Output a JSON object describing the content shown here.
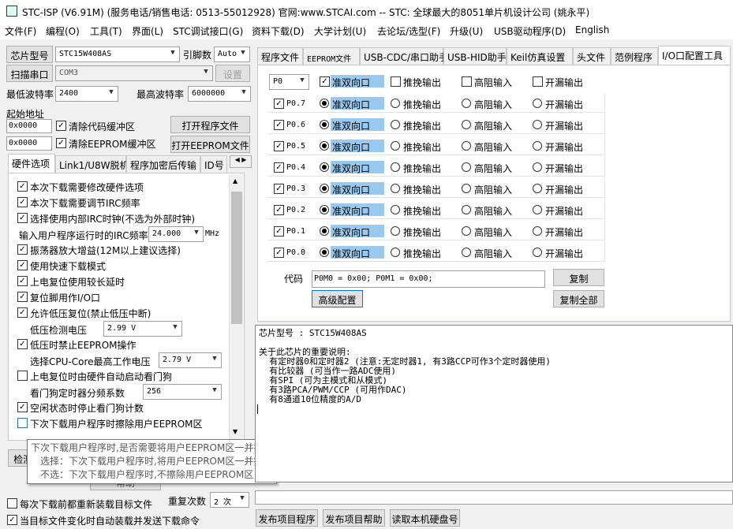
{
  "window": {
    "title": "STC-ISP (V6.91M) (服务电话/销售电话: 0513-55012928) 官网:www.STCAI.com  -- STC: 全球最大的8051单片机设计公司 (姚永平)"
  },
  "menu": [
    "文件(F)",
    "编程(O)",
    "工具(T)",
    "界面(L)",
    "STC调试接口(G)",
    "资料下载(D)",
    "大学计划(U)",
    "去论坛/选型(F)",
    "升级(U)",
    "USB驱动程序(D)",
    "English"
  ],
  "left": {
    "chip_type_label": "芯片型号",
    "chip_type_value": "STC15W408AS",
    "pin_label": "引脚数",
    "pin_value": "Auto",
    "scan_port_button": "扫描串口",
    "port_value": "COM3",
    "settings_button": "设置",
    "min_baud_label": "最低波特率",
    "min_baud_value": "2400",
    "max_baud_label": "最高波特率",
    "max_baud_value": "6000000",
    "start_addr_label": "起始地址",
    "addr1": "0x0000",
    "clear_code_buffer": "清除代码缓冲区",
    "open_program_file": "打开程序文件",
    "addr2": "0x0000",
    "clear_eeprom_buffer": "清除EEPROM缓冲区",
    "open_eeprom_file": "打开EEPROM文件",
    "tabs": [
      "硬件选项",
      "Link1/U8W脱机",
      "程序加密后传输",
      "ID号"
    ],
    "options": {
      "o1": "本次下载需要修改硬件选项",
      "o2": "本次下载需要调节IRC频率",
      "o3": "选择使用内部IRC时钟(不选为外部时钟)",
      "irc_label": "输入用户程序运行时的IRC频率",
      "irc_value": "24.000",
      "irc_unit": "MHz",
      "o4": "振荡器放大增益(12M以上建议选择)",
      "o5": "使用快速下载模式",
      "o6": "上电复位使用较长延时",
      "o7": "复位脚用作I/O口",
      "o8": "允许低压复位(禁止低压中断)",
      "lv_label": "低压检测电压",
      "lv_value": "2.99 V",
      "o9": "低压时禁止EEPROM操作",
      "cpu_label": "选择CPU-Core最高工作电压",
      "cpu_value": "2.79 V",
      "o10": "上电复位时由硬件自动启动看门狗",
      "wdt_label": "看门狗定时器分频系数",
      "wdt_value": "256",
      "o11": "空闲状态时停止看门狗计数",
      "o12": "下次下载用户程序时擦除用户EEPROM区"
    },
    "bottom_btn1": "检测MCU选项",
    "bottom_btn2": "帮助",
    "reload_each": "每次下载前都重新装载目标文件",
    "auto_send": "当目标文件变化时自动装载并发送下载命令",
    "repeat_label": "重复次数",
    "repeat_value": "2 次"
  },
  "tooltip": {
    "l1": "下次下载用户程序时,是否需要将用户EEPROM区一并擦除",
    "l2": "选择：下次下载用户程序时,将用户EEPROM区一并擦除",
    "l3": "不选：下次下载用户程序时,不擦除用户EEPROM区"
  },
  "right": {
    "tabs": [
      "程序文件",
      "EEPROM文件",
      "USB-CDC/串口助手",
      "USB-HID助手",
      "Keil仿真设置",
      "头文件",
      "范例程序",
      "I/O口配置工具"
    ],
    "port_select": "P0",
    "header_options": [
      "准双向口",
      "推挽输出",
      "高阻输入",
      "开漏输出"
    ],
    "pins": [
      "P0.7",
      "P0.6",
      "P0.5",
      "P0.4",
      "P0.3",
      "P0.2",
      "P0.1",
      "P0.0"
    ],
    "code_label": "代码",
    "code_value": "P0M0 = 0x00; P0M1 = 0x00;",
    "copy_button": "复制",
    "advanced_button": "高级配置",
    "copy_all_button": "复制全部"
  },
  "output": {
    "text": "芯片型号 : STC15W408AS\n\n关于此芯片的重要说明:\n  有定时器0和定时器2 (注意:无定时器1, 有3路CCP可作3个定时器使用)\n  有比较器 (可当作一路ADC使用)\n  有SPI (可为主模式和从模式)\n  有3路PCA/PWM/CCP (可用作DAC)\n  有8通道10位精度的A/D"
  },
  "bottom_buttons": [
    "发布项目程序",
    "发布项目帮助",
    "读取本机硬盘号"
  ],
  "colors": {
    "highlight": "#99c9ef",
    "accent": "#0078d7"
  }
}
